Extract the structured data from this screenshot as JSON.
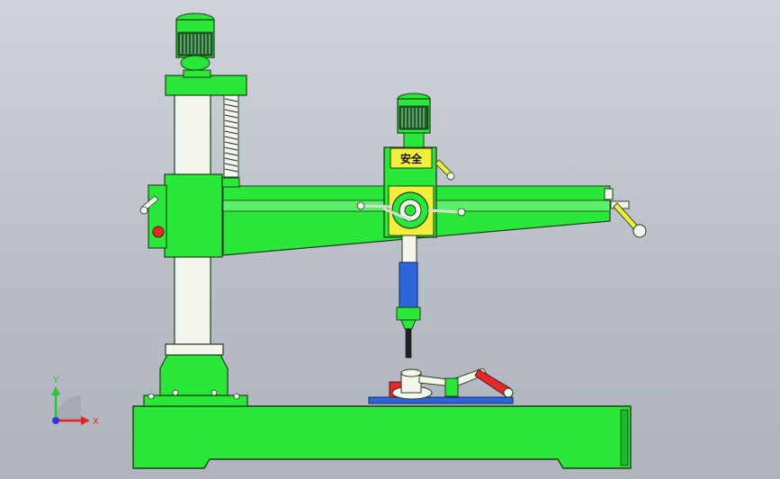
{
  "colors": {
    "body_green": "#29e83a",
    "dark_outline": "#1e3d16",
    "column_white": "#f4f6ee",
    "label_yellow": "#f2ee3c",
    "spindle_blue": "#2d66d8",
    "motor_dark": "#1f5a2a",
    "red_accent": "#e32a2a",
    "table_blue": "#3a5fd6",
    "axis_x": "#e02424",
    "axis_y": "#2fc23a",
    "axis_z": "#2a3cdc"
  },
  "head": {
    "badge_text": "安全"
  },
  "triad": {
    "x_label": "X",
    "y_label": "Y"
  }
}
